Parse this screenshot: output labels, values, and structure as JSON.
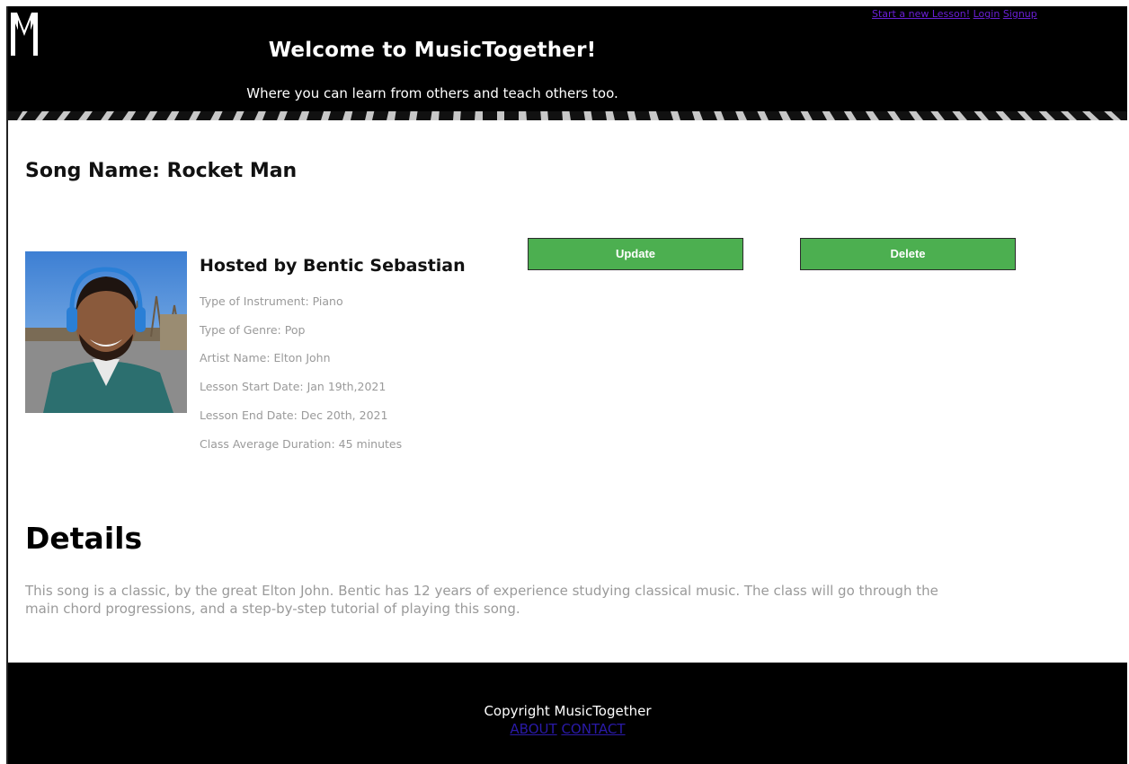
{
  "header": {
    "title": "Welcome to MusicTogether!",
    "tagline": "Where you can learn from others and teach others too.",
    "nav": {
      "new_lesson": "Start a new Lesson!",
      "login": "Login",
      "signup": "Signup"
    },
    "logo_icon": "musictogether-m-logo-icon"
  },
  "song": {
    "name_label": "Song Name: Rocket Man"
  },
  "host": {
    "name_label": "Hosted by Bentic Sebastian",
    "photo_icon": "host-avatar",
    "details": [
      "Type of Instrument: Piano",
      "Type of Genre: Pop",
      "Artist Name: Elton John",
      "Lesson Start Date: Jan 19th,2021",
      "Lesson End Date: Dec 20th, 2021",
      "Class Average Duration: 45 minutes"
    ]
  },
  "actions": {
    "update_label": "Update",
    "delete_label": "Delete",
    "button_color": "#4caf50"
  },
  "details_section": {
    "title": "Details",
    "text": "This song is a classic, by the great Elton John. Bentic has 12 years of experience studying classical music. The class will go through the main chord progressions, and a step-by-step tutorial of playing this song."
  },
  "footer": {
    "copyright": "Copyright MusicTogether",
    "about": "ABOUT",
    "contact": "CONTACT"
  }
}
